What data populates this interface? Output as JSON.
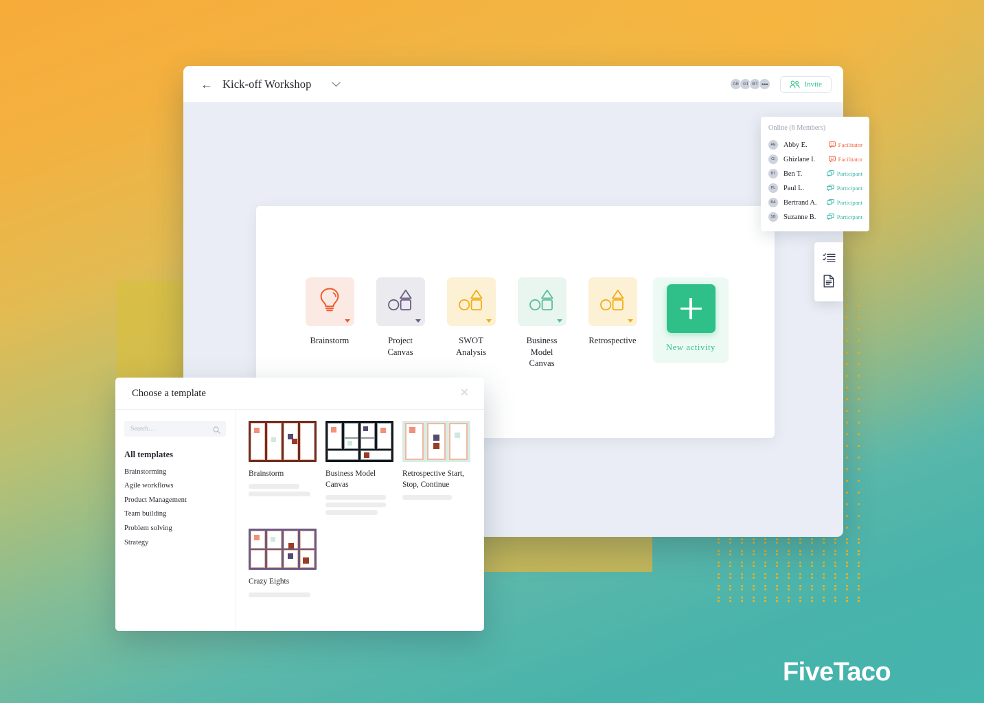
{
  "brand": {
    "name": "FiveTaco"
  },
  "app": {
    "back_icon": "back-arrow-icon",
    "title": "Kick-off Workshop",
    "chevron": "⌄",
    "avatars": [
      {
        "initials": "AE"
      },
      {
        "initials": "GI"
      },
      {
        "initials": "BT"
      },
      {
        "initials": "•••"
      }
    ],
    "invite_label": "Invite"
  },
  "members_popover": {
    "title": "Online (6 Members)",
    "rows": [
      {
        "initials": "AE",
        "name": "Abby E.",
        "role": "Facilitator",
        "role_type": "facilitator"
      },
      {
        "initials": "GI",
        "name": "Ghizlane I.",
        "role": "Facilitator",
        "role_type": "facilitator"
      },
      {
        "initials": "BT",
        "name": "Ben T.",
        "role": "Participant",
        "role_type": "participant"
      },
      {
        "initials": "PL",
        "name": "Paul L.",
        "role": "Participant",
        "role_type": "participant"
      },
      {
        "initials": "BA",
        "name": "Bertrand A.",
        "role": "Participant",
        "role_type": "participant"
      },
      {
        "initials": "SB",
        "name": "Suzanne B.",
        "role": "Participant",
        "role_type": "participant"
      }
    ]
  },
  "activities": [
    {
      "label": "Brainstorm",
      "icon": "lightbulb-icon",
      "tile_bg": "#fbeae4",
      "accent": "#f05a2d"
    },
    {
      "label": "Project\nCanvas",
      "icon": "shapes-icon",
      "tile_bg": "#eaeaef",
      "accent": "#6b5b82"
    },
    {
      "label": "SWOT\nAnalysis",
      "icon": "shapes-icon",
      "tile_bg": "#fdf1d5",
      "accent": "#f2ad15"
    },
    {
      "label": "Business\nModel\nCanvas",
      "icon": "shapes-icon",
      "tile_bg": "#e9f5ef",
      "accent": "#5bbd9b"
    },
    {
      "label": "Retrospective",
      "icon": "shapes-icon",
      "tile_bg": "#fdf1d5",
      "accent": "#f2ad15"
    }
  ],
  "new_activity": {
    "label": "New  activity",
    "icon": "plus-icon",
    "color": "#2fc08a"
  },
  "side_toolbar": [
    {
      "icon": "checklist-icon"
    },
    {
      "icon": "document-icon"
    }
  ],
  "template_modal": {
    "title": "Choose a template",
    "close_icon": "close-icon",
    "search": {
      "placeholder": "Search…",
      "value": "",
      "icon": "search-icon"
    },
    "categories": [
      {
        "label": "All templates",
        "active": true
      },
      {
        "label": "Brainstorming",
        "active": false
      },
      {
        "label": "Agile workflows",
        "active": false
      },
      {
        "label": "Product Management",
        "active": false
      },
      {
        "label": "Team building",
        "active": false
      },
      {
        "label": "Problem solving",
        "active": false
      },
      {
        "label": "Strategy",
        "active": false
      }
    ],
    "templates": [
      {
        "name": "Brainstorm",
        "thumb": "brainstorm-thumb",
        "lines": 2
      },
      {
        "name": "Business Model Canvas",
        "thumb": "bmc-thumb",
        "lines": 3
      },
      {
        "name": "Retrospective Start, Stop, Continue",
        "thumb": "retro-thumb",
        "lines": 1
      },
      {
        "name": "Crazy Eights",
        "thumb": "crazy-eights-thumb",
        "lines": 2
      }
    ]
  },
  "colors": {
    "accent_green": "#2fc08a",
    "facilitator": "#f0663f",
    "participant": "#3bb6ab",
    "bg_top": "#f7ab3a",
    "bg_bottom": "#45b5ae",
    "dot_yellow": "#f0b323"
  }
}
